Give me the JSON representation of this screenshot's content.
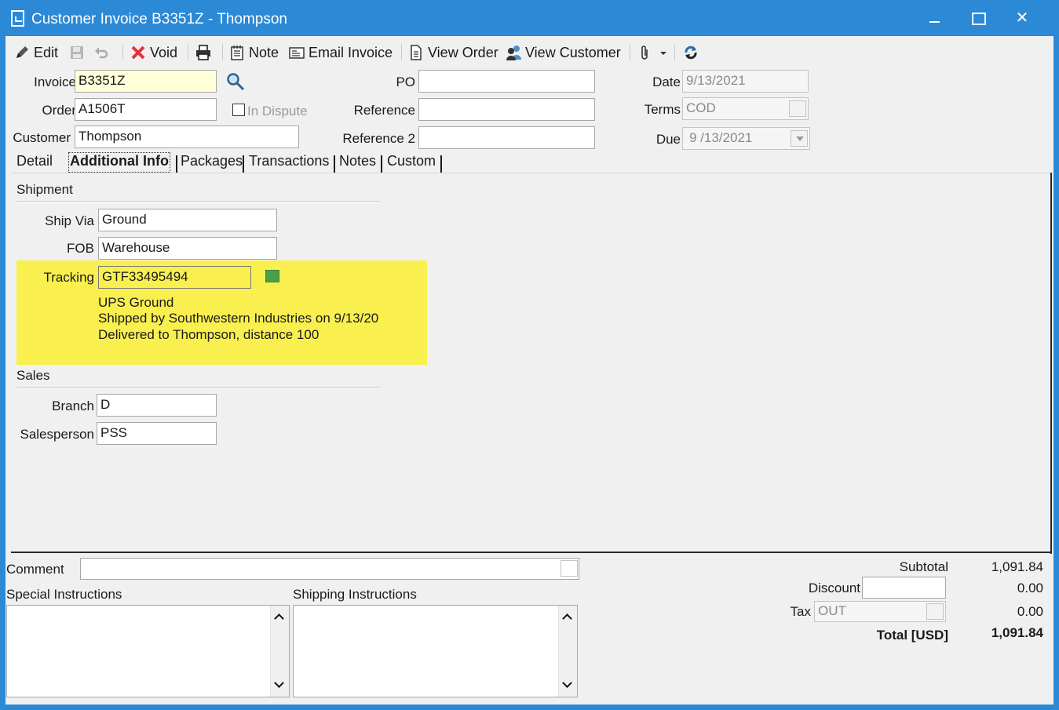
{
  "window": {
    "title": "Customer Invoice B3351Z - Thompson",
    "close_glyph": "✕"
  },
  "toolbar": {
    "edit": "Edit",
    "void": "Void",
    "note": "Note",
    "email_invoice": "Email Invoice",
    "view_order": "View Order",
    "view_customer": "View Customer"
  },
  "header": {
    "invoice_label": "Invoice",
    "invoice_value": "B3351Z",
    "order_label": "Order",
    "order_value": "A1506T",
    "in_dispute_label": "In Dispute",
    "customer_label": "Customer",
    "customer_value": "Thompson",
    "po_label": "PO",
    "po_value": "",
    "reference_label": "Reference",
    "reference_value": "",
    "reference2_label": "Reference 2",
    "reference2_value": "",
    "date_label": "Date",
    "date_value": "9/13/2021",
    "terms_label": "Terms",
    "terms_value": "COD",
    "due_label": "Due",
    "due_value": "9 /13/2021"
  },
  "tabs": [
    "Detail",
    "Additional Info",
    "Packages",
    "Transactions",
    "Notes",
    "Custom"
  ],
  "active_tab": "Additional Info",
  "shipment": {
    "section_title": "Shipment",
    "ship_via_label": "Ship Via",
    "ship_via_value": "Ground",
    "fob_label": "FOB",
    "fob_value": "Warehouse",
    "tracking_label": "Tracking",
    "tracking_value": "GTF33495494",
    "tracking_info": [
      "UPS Ground",
      "Shipped by Southwestern Industries on 9/13/20",
      "Delivered to Thompson, distance 100"
    ],
    "highlight_color": "#f9f04f"
  },
  "sales": {
    "section_title": "Sales",
    "branch_label": "Branch",
    "branch_value": "D",
    "salesperson_label": "Salesperson",
    "salesperson_value": "PSS"
  },
  "footer": {
    "comment_label": "Comment",
    "comment_value": "",
    "special_instructions_label": "Special Instructions",
    "shipping_instructions_label": "Shipping Instructions",
    "subtotal_label": "Subtotal",
    "subtotal_value": "1,091.84",
    "discount_label": "Discount",
    "discount_field": "",
    "discount_value": "0.00",
    "tax_label": "Tax",
    "tax_code": "OUT",
    "tax_value": "0.00",
    "total_label": "Total [USD]",
    "total_value": "1,091.84"
  },
  "colors": {
    "titlebar": "#2b89d6",
    "invoice_field": "#ffffd9",
    "void_icon": "#e0343c"
  }
}
